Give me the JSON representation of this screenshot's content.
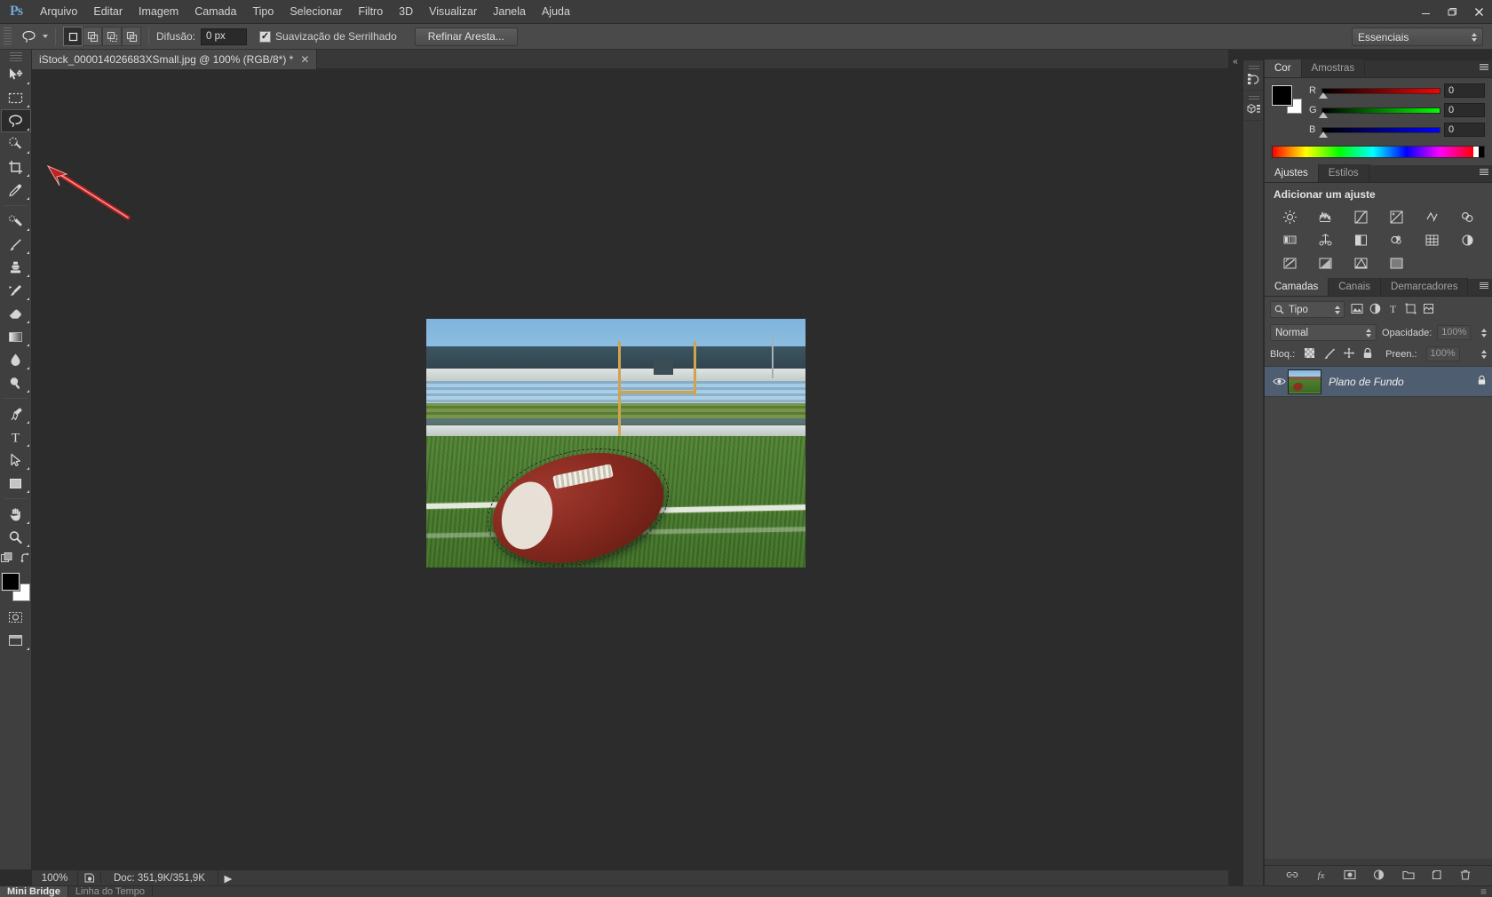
{
  "app": {
    "logo": "Ps",
    "menus": [
      "Arquivo",
      "Editar",
      "Imagem",
      "Camada",
      "Tipo",
      "Selecionar",
      "Filtro",
      "3D",
      "Visualizar",
      "Janela",
      "Ajuda"
    ],
    "window_controls": {
      "minimize": "—",
      "restore": "❐",
      "close": "✕"
    }
  },
  "options_bar": {
    "tool_icon": "lasso-icon",
    "selection_modes": [
      "new-selection",
      "add-to-selection",
      "subtract-from-selection",
      "intersect-with-selection"
    ],
    "feather_label": "Difusão:",
    "feather_value": "0 px",
    "antialias_label": "Suavização de Serrilhado",
    "antialias_checked": true,
    "refine_edge_label": "Refinar Aresta...",
    "workspace": "Essenciais"
  },
  "toolbar": {
    "tools": [
      {
        "name": "move-tool",
        "active": false
      },
      {
        "name": "rectangular-marquee-tool",
        "active": false
      },
      {
        "name": "lasso-tool",
        "active": true
      },
      {
        "name": "quick-selection-tool",
        "active": false
      },
      {
        "name": "crop-tool",
        "active": false
      },
      {
        "name": "eyedropper-tool",
        "active": false
      },
      {
        "name": "spot-healing-brush-tool",
        "active": false
      },
      {
        "name": "brush-tool",
        "active": false
      },
      {
        "name": "clone-stamp-tool",
        "active": false
      },
      {
        "name": "history-brush-tool",
        "active": false
      },
      {
        "name": "eraser-tool",
        "active": false
      },
      {
        "name": "gradient-tool",
        "active": false
      },
      {
        "name": "blur-tool",
        "active": false
      },
      {
        "name": "dodge-tool",
        "active": false
      },
      {
        "name": "pen-tool",
        "active": false
      },
      {
        "name": "horizontal-type-tool",
        "active": false
      },
      {
        "name": "path-selection-tool",
        "active": false
      },
      {
        "name": "rectangle-tool",
        "active": false
      },
      {
        "name": "hand-tool",
        "active": false
      },
      {
        "name": "zoom-tool",
        "active": false
      }
    ],
    "foreground_color": "#000000",
    "background_color": "#ffffff"
  },
  "document": {
    "tab_title": "iStock_000014026683XSmall.jpg @ 100% (RGB/8*) *",
    "close_label": "✕"
  },
  "canvas": {
    "annotation": "red-arrow-pointing-to-lasso-tool",
    "annotation_color": "#c02020",
    "selection_state": "marching-ants-around-football"
  },
  "status_bar": {
    "zoom": "100%",
    "doc_info": "Doc: 351,9K/351,9K",
    "expand_arrow": "▶"
  },
  "bottom_bar": {
    "tabs": [
      {
        "label": "Mini Bridge",
        "active": true
      },
      {
        "label": "Linha do Tempo",
        "active": false
      }
    ]
  },
  "icon_rail": {
    "items": [
      "history-panel-icon",
      "3d-panel-icon"
    ]
  },
  "color_panel": {
    "tabs": [
      {
        "label": "Cor",
        "active": true
      },
      {
        "label": "Amostras",
        "active": false
      }
    ],
    "foreground": "#000000",
    "background": "#ffffff",
    "channels": [
      {
        "label": "R",
        "value": "0"
      },
      {
        "label": "G",
        "value": "0"
      },
      {
        "label": "B",
        "value": "0"
      }
    ]
  },
  "adjustments_panel": {
    "tabs": [
      {
        "label": "Ajustes",
        "active": true
      },
      {
        "label": "Estilos",
        "active": false
      }
    ],
    "title": "Adicionar um ajuste",
    "icons": [
      "brightness-contrast-icon",
      "levels-icon",
      "curves-icon",
      "exposure-icon",
      "vibrance-icon",
      "hue-saturation-icon",
      "color-balance-icon",
      "black-white-icon",
      "photo-filter-icon",
      "channel-mixer-icon",
      "color-lookup-icon",
      "invert-icon",
      "posterize-icon",
      "threshold-icon",
      "gradient-map-icon"
    ]
  },
  "layers_panel": {
    "tabs": [
      {
        "label": "Camadas",
        "active": true
      },
      {
        "label": "Canais",
        "active": false
      },
      {
        "label": "Demarcadores",
        "active": false
      }
    ],
    "filter_label": "Tipo",
    "filter_icons": [
      "pixel-layer-filter-icon",
      "adjustment-layer-filter-icon",
      "type-layer-filter-icon",
      "shape-layer-filter-icon",
      "smart-object-filter-icon"
    ],
    "blend_mode": "Normal",
    "opacity_label": "Opacidade:",
    "opacity_value": "100%",
    "lock_label": "Bloq.:",
    "lock_icons": [
      "lock-transparent-pixels-icon",
      "lock-image-pixels-icon",
      "lock-position-icon",
      "lock-all-icon"
    ],
    "fill_label": "Preen.:",
    "fill_value": "100%",
    "layers": [
      {
        "name": "Plano de Fundo",
        "visible": true,
        "locked": true,
        "selected": true
      }
    ],
    "footer_icons": [
      "link-layers-icon",
      "layer-style-icon",
      "layer-mask-icon",
      "new-adjustment-layer-icon",
      "new-group-icon",
      "new-layer-icon",
      "delete-layer-icon"
    ]
  }
}
